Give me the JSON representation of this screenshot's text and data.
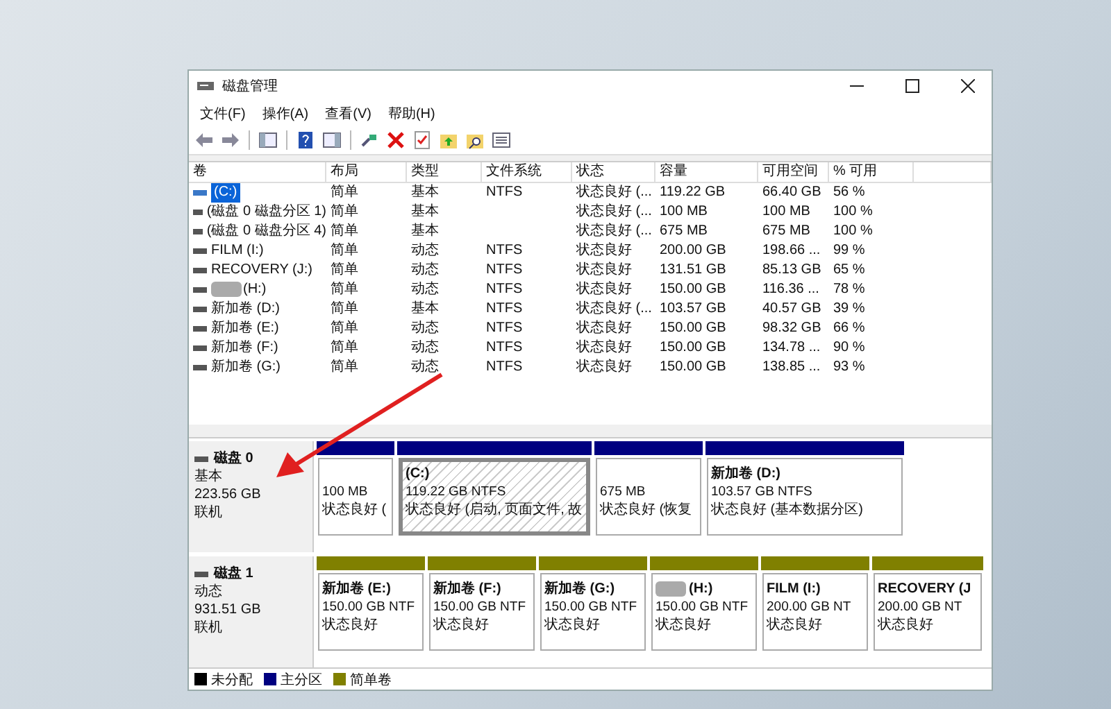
{
  "window": {
    "title": "磁盘管理"
  },
  "menu": [
    "文件(F)",
    "操作(A)",
    "查看(V)",
    "帮助(H)"
  ],
  "table": {
    "columns": [
      "卷",
      "布局",
      "类型",
      "文件系统",
      "状态",
      "容量",
      "可用空间",
      "% 可用"
    ],
    "rows": [
      {
        "selected": true,
        "cells": [
          "(C:)",
          "简单",
          "基本",
          "NTFS",
          "状态良好 (...",
          "119.22 GB",
          "66.40 GB",
          "56 %"
        ]
      },
      {
        "selected": false,
        "cells": [
          "(磁盘 0 磁盘分区 1)",
          "简单",
          "基本",
          "",
          "状态良好 (...",
          "100 MB",
          "100 MB",
          "100 %"
        ]
      },
      {
        "selected": false,
        "cells": [
          "(磁盘 0 磁盘分区 4)",
          "简单",
          "基本",
          "",
          "状态良好 (...",
          "675 MB",
          "675 MB",
          "100 %"
        ]
      },
      {
        "selected": false,
        "cells": [
          "FILM (I:)",
          "简单",
          "动态",
          "NTFS",
          "状态良好",
          "200.00 GB",
          "198.66 ...",
          "99 %"
        ]
      },
      {
        "selected": false,
        "cells": [
          "RECOVERY (J:)",
          "简单",
          "动态",
          "NTFS",
          "状态良好",
          "131.51 GB",
          "85.13 GB",
          "65 %"
        ]
      },
      {
        "selected": false,
        "redacted": true,
        "cells": [
          "(H:)",
          "简单",
          "动态",
          "NTFS",
          "状态良好",
          "150.00 GB",
          "116.36 ...",
          "78 %"
        ]
      },
      {
        "selected": false,
        "cells": [
          "新加卷 (D:)",
          "简单",
          "基本",
          "NTFS",
          "状态良好 (...",
          "103.57 GB",
          "40.57 GB",
          "39 %"
        ]
      },
      {
        "selected": false,
        "cells": [
          "新加卷 (E:)",
          "简单",
          "动态",
          "NTFS",
          "状态良好",
          "150.00 GB",
          "98.32 GB",
          "66 %"
        ]
      },
      {
        "selected": false,
        "cells": [
          "新加卷 (F:)",
          "简单",
          "动态",
          "NTFS",
          "状态良好",
          "150.00 GB",
          "134.78 ...",
          "90 %"
        ]
      },
      {
        "selected": false,
        "cells": [
          "新加卷 (G:)",
          "简单",
          "动态",
          "NTFS",
          "状态良好",
          "150.00 GB",
          "138.85 ...",
          "93 %"
        ]
      }
    ]
  },
  "disks": [
    {
      "name": "磁盘 0",
      "type": "基本",
      "size": "223.56 GB",
      "status": "联机",
      "partitions": [
        {
          "kind": "primary",
          "selected": false,
          "size": "100 MB",
          "status": "状态良好 ("
        },
        {
          "kind": "primary",
          "selected": true,
          "name": "(C:)",
          "size": "119.22 GB NTFS",
          "status": "状态良好 (启动, 页面文件, 故"
        },
        {
          "kind": "primary",
          "selected": false,
          "size": "675 MB",
          "status": "状态良好 (恢复"
        },
        {
          "kind": "primary",
          "selected": false,
          "name": "新加卷 (D:)",
          "size": "103.57 GB NTFS",
          "status": "状态良好 (基本数据分区)"
        }
      ]
    },
    {
      "name": "磁盘 1",
      "type": "动态",
      "size": "931.51 GB",
      "status": "联机",
      "partitions": [
        {
          "kind": "simple",
          "selected": false,
          "name": "新加卷 (E:)",
          "size": "150.00 GB NTF",
          "status": "状态良好"
        },
        {
          "kind": "simple",
          "selected": false,
          "name": "新加卷 (F:)",
          "size": "150.00 GB NTF",
          "status": "状态良好"
        },
        {
          "kind": "simple",
          "selected": false,
          "name": "新加卷 (G:)",
          "size": "150.00 GB NTF",
          "status": "状态良好"
        },
        {
          "kind": "simple",
          "selected": false,
          "redacted": true,
          "name": "(H:)",
          "size": "150.00 GB NTF",
          "status": "状态良好"
        },
        {
          "kind": "simple",
          "selected": false,
          "name": "FILM (I:)",
          "size": "200.00 GB NT",
          "status": "状态良好"
        },
        {
          "kind": "simple",
          "selected": false,
          "name": "RECOVERY (J",
          "size": "200.00 GB NT",
          "status": "状态良好"
        }
      ]
    }
  ],
  "legend": [
    {
      "label": "未分配",
      "color": "#000000"
    },
    {
      "label": "主分区",
      "color": "#000080"
    },
    {
      "label": "简单卷",
      "color": "#808000"
    }
  ]
}
